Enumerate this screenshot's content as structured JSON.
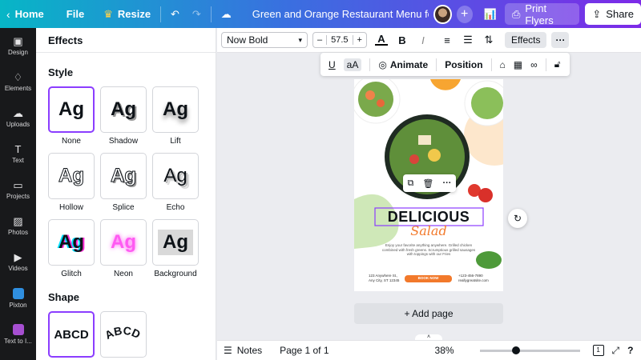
{
  "topbar": {
    "home_label": "Home",
    "file_label": "File",
    "resize_label": "Resize",
    "doc_title": "Green and Orange Restaurant Menu for Fa ...",
    "print_label": "Print Flyers",
    "share_label": "Share"
  },
  "sidebar": {
    "items": [
      {
        "label": "Design",
        "icon": "design-icon"
      },
      {
        "label": "Elements",
        "icon": "elements-icon"
      },
      {
        "label": "Uploads",
        "icon": "uploads-icon"
      },
      {
        "label": "Text",
        "icon": "text-icon"
      },
      {
        "label": "Projects",
        "icon": "projects-icon"
      },
      {
        "label": "Photos",
        "icon": "photos-icon"
      },
      {
        "label": "Videos",
        "icon": "videos-icon"
      },
      {
        "label": "Pixton",
        "icon": "pixton-icon"
      },
      {
        "label": "Text to I...",
        "icon": "text-to-image-icon"
      }
    ]
  },
  "panel": {
    "title": "Effects",
    "style_title": "Style",
    "sample_text": "Ag",
    "effects": [
      "None",
      "Shadow",
      "Lift",
      "Hollow",
      "Splice",
      "Echo",
      "Glitch",
      "Neon",
      "Background"
    ],
    "shape_title": "Shape",
    "shape_text": "ABCD"
  },
  "toolbar": {
    "font": "Now Bold",
    "size": "57.5",
    "minus": "–",
    "plus": "+",
    "effects_label": "Effects",
    "more": "···"
  },
  "floatbar": {
    "case_label": "aA",
    "animate_label": "Animate",
    "position_label": "Position"
  },
  "canvas": {
    "headline": "DELICIOUS",
    "script": "Salad",
    "body_text": "Enjoy your favorite anything anywhere. Grilled chicken combined with fresh greens. Scrumptious grilled sausages with toppings with our Fries",
    "address_line1": "123 Anywhere St.,",
    "address_line2": "Any City, ST 12345",
    "book_label": "BOOK NOW",
    "phone": "+123-456-7890",
    "site": "reallygreatsite.com",
    "add_page_label": "+ Add page"
  },
  "bottombar": {
    "notes_label": "Notes",
    "page_label": "Page 1 of 1",
    "zoom": "38%",
    "zoom_fraction": 0.38,
    "page_count": "1"
  },
  "colors": {
    "accent": "#8b3dff",
    "orange": "#f2792b",
    "green": "#c9e6b5",
    "topbar_left": "#07b6c6",
    "topbar_right": "#7d2ae8"
  }
}
